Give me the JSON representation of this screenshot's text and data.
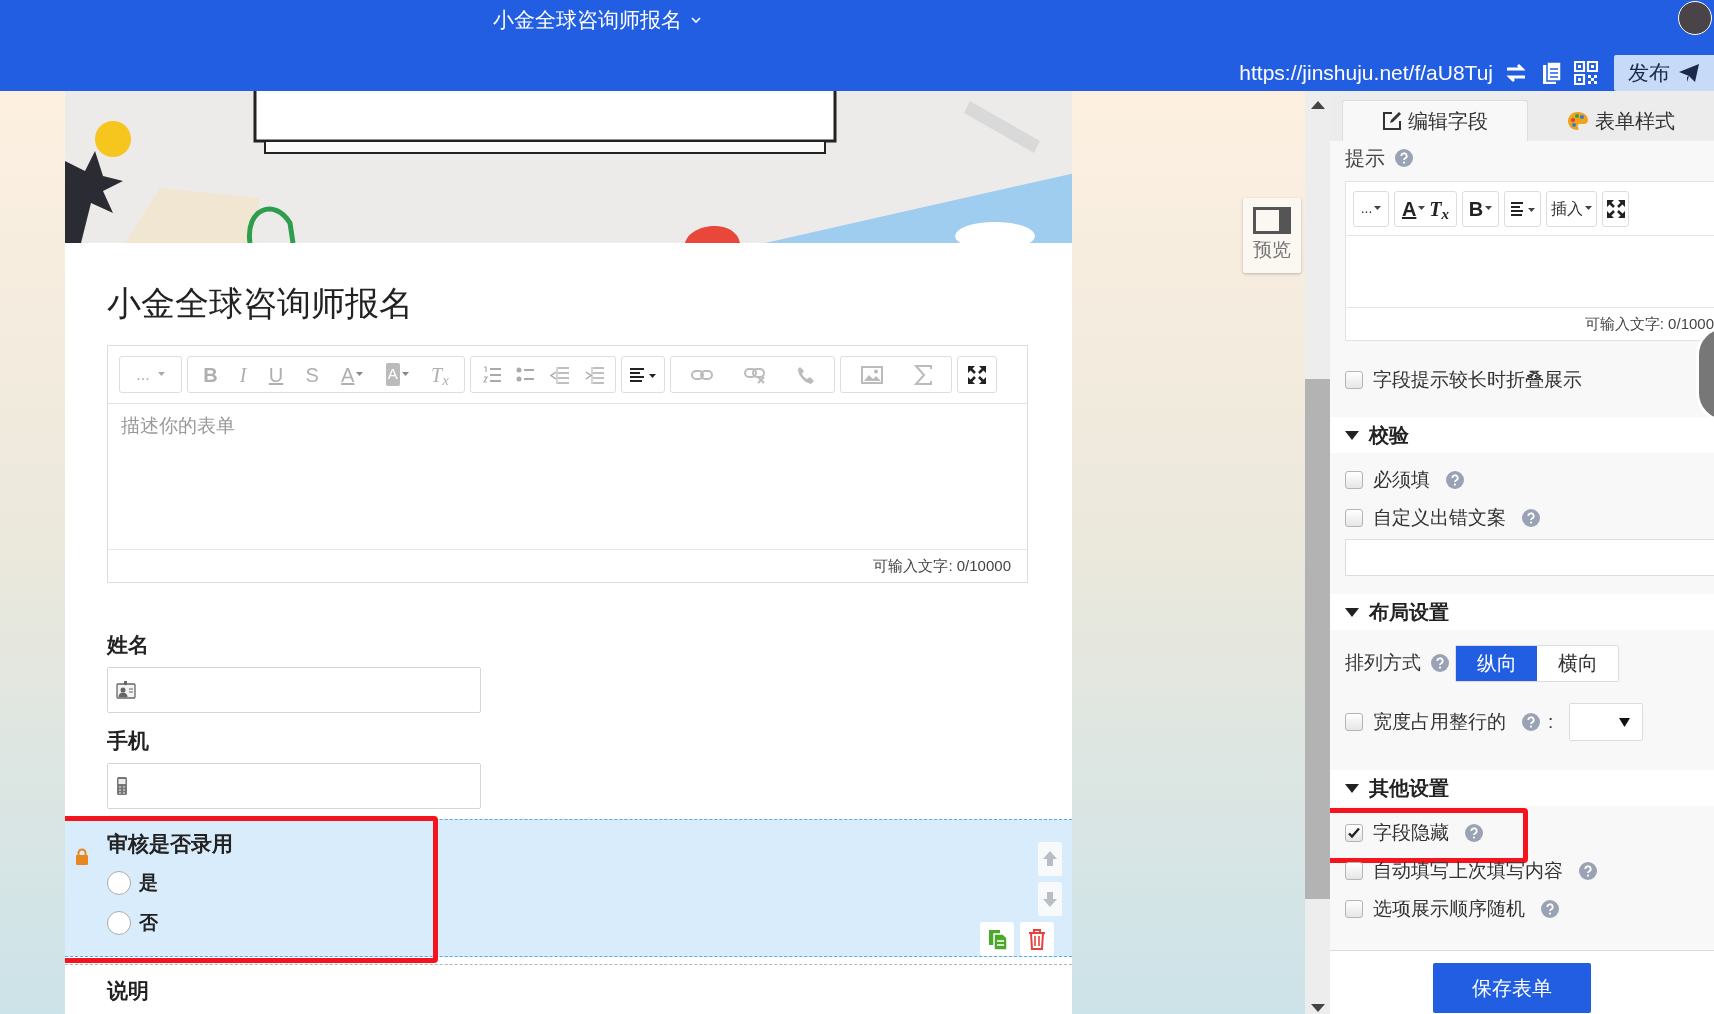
{
  "top_bar": {
    "title": "小金全球咨询师报名",
    "url": "https://jinshuju.net/f/aU8Tuj",
    "publish_button": "发布"
  },
  "preview_button": "预览",
  "form": {
    "title": "小金全球咨询师报名",
    "editor": {
      "format_menu": "...",
      "letters": [
        "B",
        "I",
        "U",
        "S",
        "A",
        "A",
        "T$_{x}$"
      ],
      "placeholder": "描述你的表单",
      "counter": "可输入文字: 0/10000"
    },
    "fields": [
      {
        "kind": "contact",
        "label": "姓名",
        "selected": false,
        "highlighted": false
      },
      {
        "kind": "mobile",
        "label": "手机",
        "selected": false,
        "highlighted": false
      },
      {
        "kind": "radio",
        "label": "审核是否录用",
        "selected": true,
        "locked": true,
        "highlighted": true,
        "options": [
          {
            "label": "是",
            "selected": false
          },
          {
            "label": "否",
            "selected": false
          }
        ]
      },
      {
        "kind": "description",
        "label": "说明",
        "selected": false,
        "highlighted": false
      }
    ]
  },
  "panel": {
    "tabs": [
      {
        "label": "编辑字段",
        "selected": true
      },
      {
        "label": "表单样式",
        "selected": false
      }
    ],
    "hint": {
      "label": "提示",
      "format_menu": "...",
      "letters": [
        "A",
        "T$_{x}$",
        "B"
      ],
      "insert_menu": "插入",
      "counter": "可输入文字: 0/1000"
    },
    "fold_hint": {
      "label": "字段提示较长时折叠展示",
      "checked": false
    },
    "sections": [
      {
        "title": "校验",
        "expanded": true,
        "items": [
          {
            "kind": "checkbox",
            "label": "必须填",
            "checked": false,
            "highlighted": false
          },
          {
            "kind": "checkbox",
            "label": "自定义出错文案",
            "checked": false,
            "highlighted": false
          },
          {
            "kind": "input"
          }
        ]
      },
      {
        "title": "布局设置",
        "expanded": true,
        "items": [
          {
            "kind": "segmented",
            "label": "排列方式",
            "options": [
              {
                "label": "纵向",
                "selected": true
              },
              {
                "label": "横向",
                "selected": false
              }
            ]
          },
          {
            "kind": "checkbox_select",
            "label": "宽度占用整行的",
            "checked": false,
            "suffix": ":"
          }
        ]
      },
      {
        "title": "其他设置",
        "expanded": true,
        "items": [
          {
            "kind": "checkbox",
            "label": "字段隐藏",
            "checked": true,
            "highlighted": true
          },
          {
            "kind": "checkbox",
            "label": "自动填写上次填写内容",
            "checked": false,
            "highlighted": false
          },
          {
            "kind": "checkbox",
            "label": "选项展示顺序随机",
            "checked": false,
            "highlighted": false
          }
        ]
      }
    ],
    "save_button": "保存表单"
  }
}
